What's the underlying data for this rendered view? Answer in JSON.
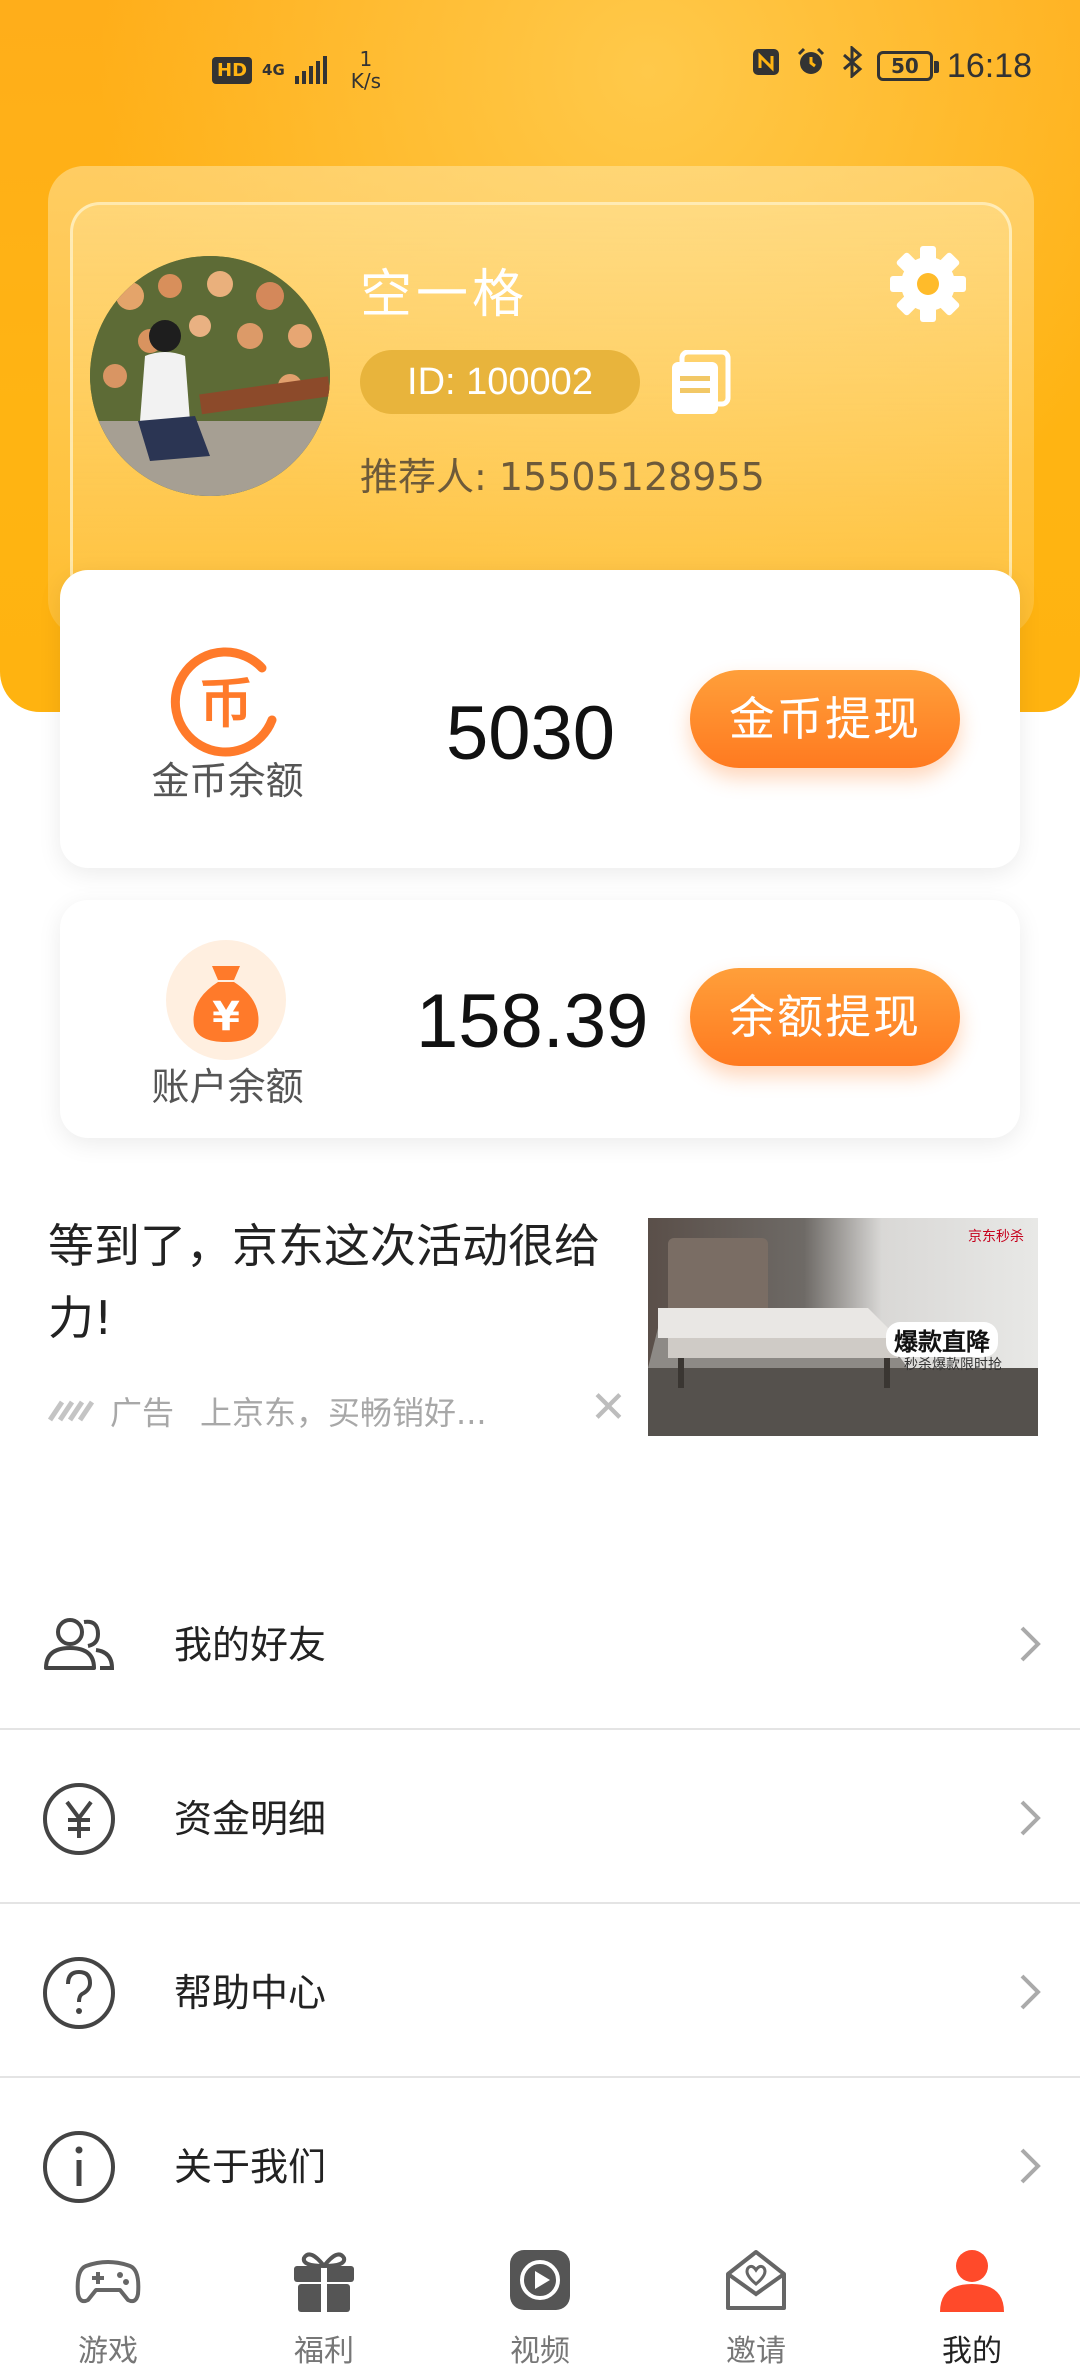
{
  "status_bar": {
    "hd": "HD",
    "network": "4G",
    "speed_value": "1",
    "speed_unit": "K/s",
    "battery": "50",
    "time": "16:18"
  },
  "profile": {
    "username": "空一格",
    "id_text": "ID: 100002",
    "referrer": "推荐人: 15505128955"
  },
  "coin_balance": {
    "label": "金币余额",
    "value": "5030",
    "button": "金币提现",
    "icon": "coin-icon"
  },
  "account_balance": {
    "label": "账户余额",
    "value": "158.39",
    "button": "余额提现",
    "icon": "money-bag-icon"
  },
  "ad": {
    "headline": "等到了，京东这次活动很给力!",
    "tag": "广告",
    "source": "上京东，买畅销好...",
    "banner_title": "爆款直降",
    "banner_sub": "秒杀爆款限时抢",
    "banner_brand": "京东秒杀"
  },
  "menu": [
    {
      "label": "我的好友",
      "icon": "friends-icon"
    },
    {
      "label": "资金明细",
      "icon": "yuan-icon"
    },
    {
      "label": "帮助中心",
      "icon": "help-icon"
    },
    {
      "label": "关于我们",
      "icon": "info-icon"
    }
  ],
  "bottom_nav": [
    {
      "label": "游戏",
      "icon": "gamepad-icon"
    },
    {
      "label": "福利",
      "icon": "gift-icon"
    },
    {
      "label": "视频",
      "icon": "video-icon"
    },
    {
      "label": "邀请",
      "icon": "invite-icon"
    },
    {
      "label": "我的",
      "icon": "profile-icon",
      "active": true
    }
  ],
  "colors": {
    "accent": "#FF8A25",
    "header": "#FFB412",
    "active_nav": "#FF4A2A"
  }
}
